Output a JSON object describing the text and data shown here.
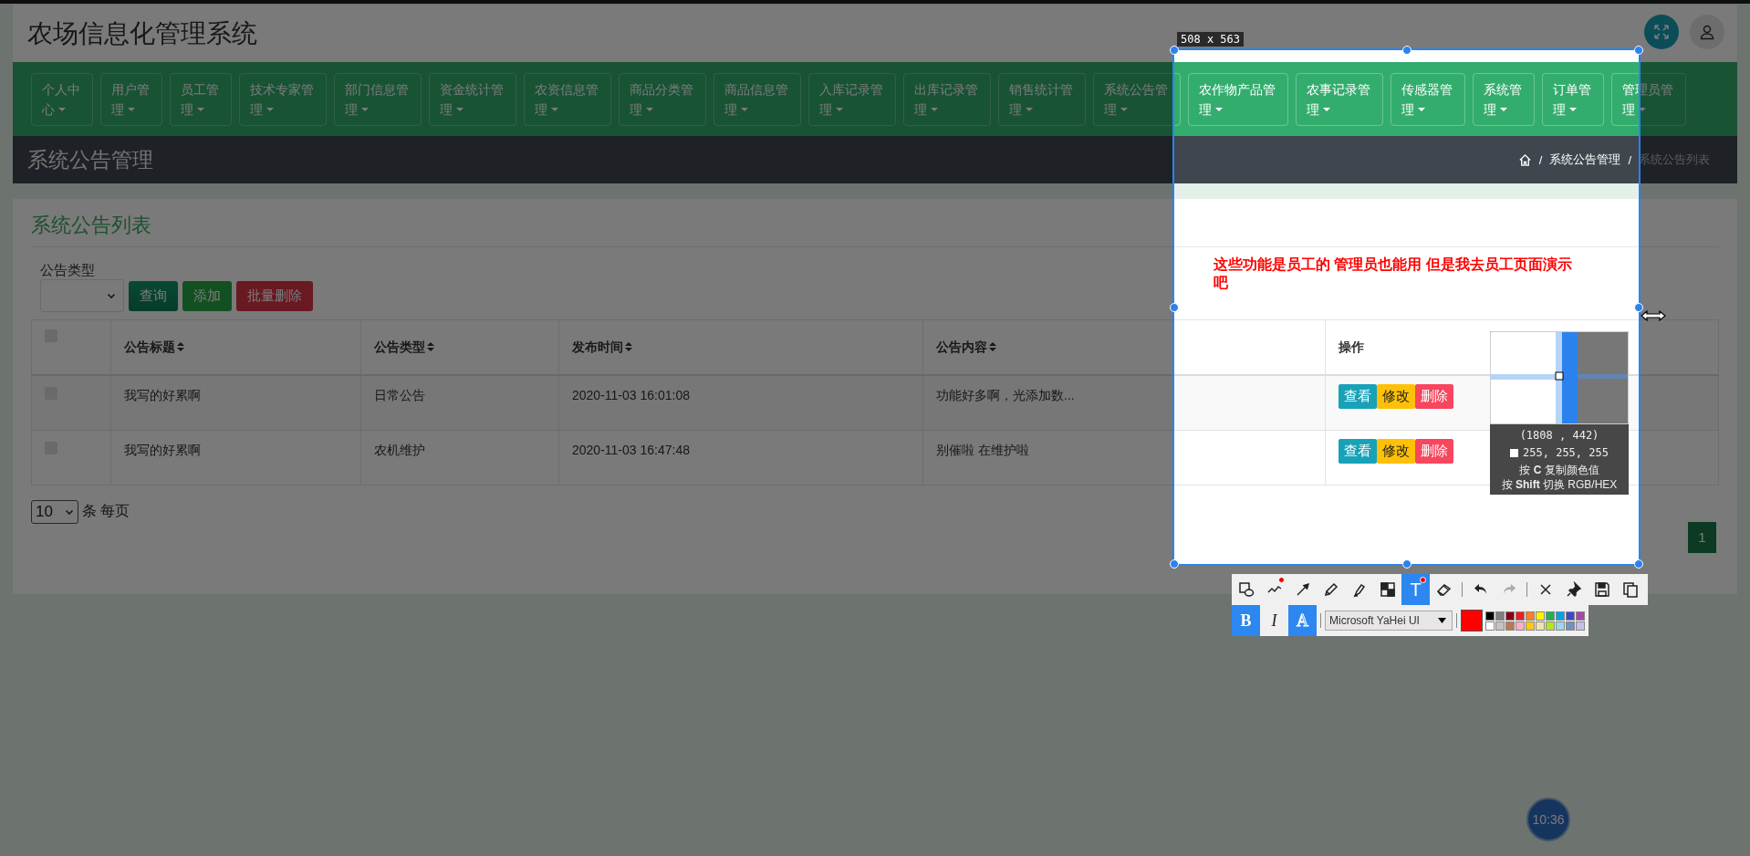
{
  "header": {
    "title": "农场信息化管理系统"
  },
  "nav": [
    {
      "label": "个人中心"
    },
    {
      "label": "用户管理"
    },
    {
      "label": "员工管理"
    },
    {
      "label": "技术专家管理"
    },
    {
      "label": "部门信息管理"
    },
    {
      "label": "资金统计管理"
    },
    {
      "label": "农资信息管理"
    },
    {
      "label": "商品分类管理"
    },
    {
      "label": "商品信息管理"
    },
    {
      "label": "入库记录管理"
    },
    {
      "label": "出库记录管理"
    },
    {
      "label": "销售统计管理"
    },
    {
      "label": "系统公告管理"
    },
    {
      "label": "农作物产品管理"
    },
    {
      "label": "农事记录管理"
    },
    {
      "label": "传感器管理"
    },
    {
      "label": "系统管理"
    },
    {
      "label": "订单管理"
    },
    {
      "label": "管理员管理"
    }
  ],
  "page_header": {
    "title": "系统公告管理",
    "breadcrumb": [
      {
        "kind": "home"
      },
      {
        "kind": "separator",
        "text": "/"
      },
      {
        "kind": "link",
        "text": "系统公告管理"
      },
      {
        "kind": "separator",
        "text": "/"
      },
      {
        "kind": "current",
        "text": "系统公告列表"
      }
    ]
  },
  "card": {
    "title": "系统公告列表"
  },
  "filter": {
    "label": "公告类型",
    "buttons": [
      {
        "label": "查询",
        "kind": "query"
      },
      {
        "label": "添加",
        "kind": "add"
      },
      {
        "label": "批量删除",
        "kind": "delete"
      }
    ]
  },
  "table": {
    "select_all": false,
    "columns": [
      {
        "label": "公告标题",
        "sortable": true
      },
      {
        "label": "公告类型",
        "sortable": true
      },
      {
        "label": "发布时间",
        "sortable": true
      },
      {
        "label": "公告内容",
        "sortable": true
      },
      {
        "label": "操作",
        "sortable": false
      }
    ],
    "rows": [
      {
        "checked": false,
        "cells": [
          "我写的好累啊",
          "日常公告",
          "2020-11-03 16:01:08",
          "功能好多啊，光添加数..."
        ],
        "actions": [
          {
            "label": "查看",
            "kind": "view"
          },
          {
            "label": "修改",
            "kind": "edit"
          },
          {
            "label": "删除",
            "kind": "delete"
          }
        ]
      },
      {
        "checked": false,
        "cells": [
          "我写的好累啊",
          "农机维护",
          "2020-11-03 16:47:48",
          "别催啦 在维护啦"
        ],
        "actions": [
          {
            "label": "查看",
            "kind": "view"
          },
          {
            "label": "修改",
            "kind": "edit"
          },
          {
            "label": "删除",
            "kind": "delete"
          }
        ]
      }
    ]
  },
  "pagination": {
    "page_size": "10",
    "page_size_label": "条 每页",
    "pages": [
      {
        "label": "1",
        "selected": true
      }
    ]
  },
  "screenshot_tool": {
    "size_label": "508 x 563",
    "annotation": "这些功能是员工的 管理员也能用 但是我去员工页面演示吧",
    "magnifier": {
      "coords": "(1808 , 442)",
      "color": "#ffffff",
      "color_value": "255, 255, 255",
      "hints": [
        "按 **C** 复制颜色值",
        "按 **Shift** 切换 RGB/HEX"
      ]
    },
    "toolbar_groups": [
      {
        "items": [
          {
            "kind": "shape",
            "selected": false,
            "dot": false,
            "disabled": false
          },
          {
            "kind": "line",
            "selected": false,
            "dot": true,
            "disabled": false
          },
          {
            "kind": "arrow",
            "selected": false,
            "dot": false,
            "disabled": false
          },
          {
            "kind": "pencil",
            "selected": false,
            "dot": false,
            "disabled": false
          },
          {
            "kind": "marker",
            "selected": false,
            "dot": false,
            "disabled": false
          },
          {
            "kind": "mosaic",
            "selected": false,
            "dot": false,
            "disabled": false
          },
          {
            "kind": "text",
            "label": "T",
            "selected": true,
            "dot": true,
            "disabled": false
          },
          {
            "kind": "eraser",
            "selected": false,
            "dot": false,
            "disabled": false
          }
        ]
      },
      {
        "items": [
          {
            "kind": "undo",
            "selected": false,
            "dot": false,
            "disabled": false
          },
          {
            "kind": "redo",
            "selected": false,
            "dot": false,
            "disabled": true
          }
        ]
      },
      {
        "items": [
          {
            "kind": "close",
            "selected": false,
            "dot": false,
            "disabled": false
          },
          {
            "kind": "pin",
            "selected": false,
            "dot": false,
            "disabled": false
          },
          {
            "kind": "save",
            "selected": false,
            "dot": false,
            "disabled": false
          },
          {
            "kind": "copy",
            "selected": false,
            "dot": false,
            "disabled": false
          }
        ]
      }
    ],
    "text_style": [
      {
        "label": "B",
        "kind": "bold",
        "selected": true
      },
      {
        "label": "I",
        "kind": "italic",
        "selected": false
      },
      {
        "label": "A",
        "kind": "outline",
        "selected": true
      }
    ],
    "font": "Microsoft YaHei UI",
    "current": {
      "color": "#ff0000"
    },
    "palette": [
      {
        "color": "#000000"
      },
      {
        "color": "#7f7f7f"
      },
      {
        "color": "#880015"
      },
      {
        "color": "#ed1c24"
      },
      {
        "color": "#ff7f27"
      },
      {
        "color": "#fff200"
      },
      {
        "color": "#22b14c"
      },
      {
        "color": "#00a2e8"
      },
      {
        "color": "#3f48cc"
      },
      {
        "color": "#a349a4"
      },
      {
        "color": "#ffffff"
      },
      {
        "color": "#c3c3c3"
      },
      {
        "color": "#b97a57"
      },
      {
        "color": "#ffaec9"
      },
      {
        "color": "#ffc90e"
      },
      {
        "color": "#efe4b0"
      },
      {
        "color": "#b5e61d"
      },
      {
        "color": "#99d9ea"
      },
      {
        "color": "#7092be"
      },
      {
        "color": "#c8bfe7"
      }
    ]
  },
  "clock": {
    "time": "10:36"
  }
}
